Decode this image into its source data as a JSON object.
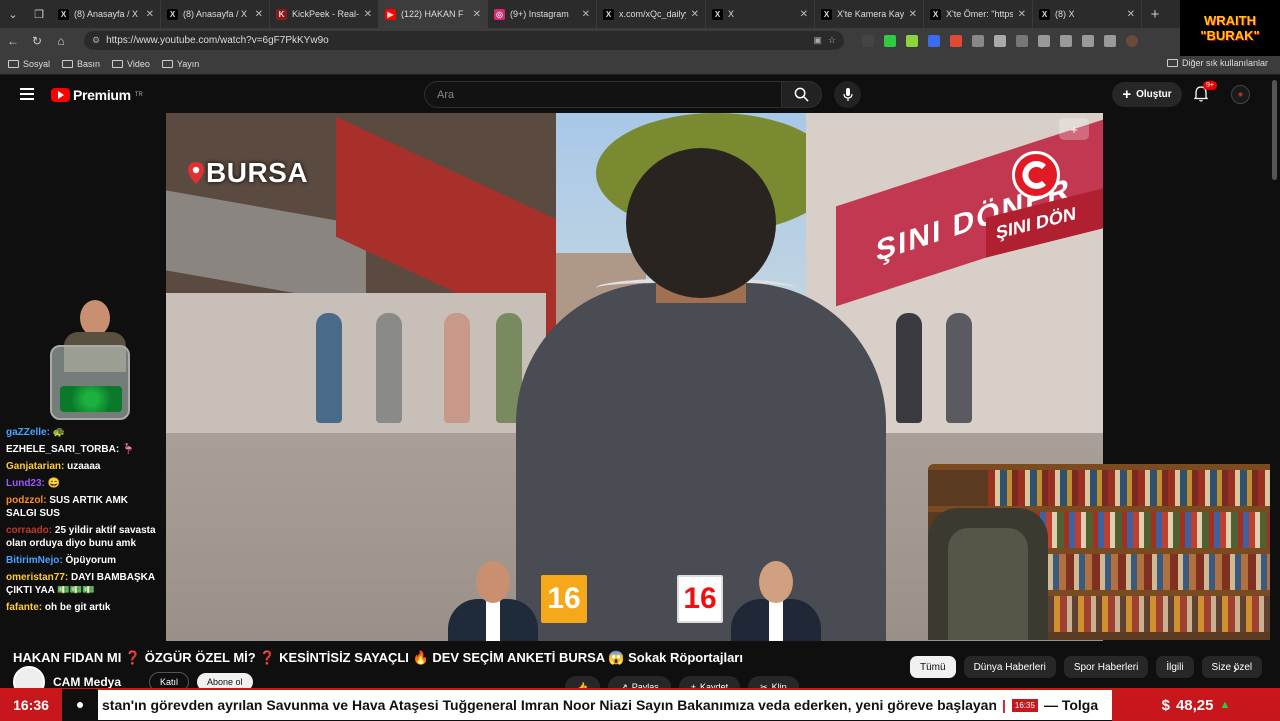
{
  "browser": {
    "tabs": [
      {
        "title": "(8) Anasayfa / X",
        "icon": "x-logo-icon",
        "fav_color": "#000000",
        "glyph": "X"
      },
      {
        "title": "(8) Anasayfa / X",
        "icon": "x-logo-icon",
        "fav_color": "#000000",
        "glyph": "X"
      },
      {
        "title": "KickPeek - Real-time",
        "icon": "kickpeek-icon",
        "fav_color": "#8b1a1a",
        "glyph": "K"
      },
      {
        "title": "(122) HAKAN F",
        "icon": "youtube-icon",
        "fav_color": "#ff0000",
        "glyph": "▶"
      },
      {
        "title": "(9+) Instagram",
        "icon": "instagram-icon",
        "fav_color": "#d62976",
        "glyph": "◎"
      },
      {
        "title": "x.com/xQc_dailyy/st",
        "icon": "x-logo-icon",
        "fav_color": "#000000",
        "glyph": "X"
      },
      {
        "title": "X",
        "icon": "x-logo-icon",
        "fav_color": "#000000",
        "glyph": "X"
      },
      {
        "title": "X'te Kamera Kaydı G",
        "icon": "x-logo-icon",
        "fav_color": "#000000",
        "glyph": "X"
      },
      {
        "title": "X'te Ömer: \"https://x",
        "icon": "x-logo-icon",
        "fav_color": "#000000",
        "glyph": "X"
      },
      {
        "title": "(8) X",
        "icon": "x-logo-icon",
        "fav_color": "#000000",
        "glyph": "X"
      }
    ],
    "url": "https://www.youtube.com/watch?v=6gF7PkKYw9o",
    "bookmarks": [
      "Sosyal",
      "Basın",
      "Video",
      "Yayın"
    ],
    "other_bookmarks": "Diğer sık kullanılanlar",
    "overlay_line1": "WRAITH",
    "overlay_line2": "\"BURAK\""
  },
  "youtube": {
    "brand": "Premium",
    "region": "TR",
    "search_placeholder": "Ara",
    "create_label": "Oluştur",
    "notif_badge": "9+",
    "video_title": "HAKAN FIDAN MI ❓ ÖZGÜR ÖZEL Mİ? ❓ KESİNTİSİZ SAYAÇLI 🔥 DEV SEÇİM ANKETİ BURSA 😱 Sokak Röportajları",
    "channel_name": "CAM Medya",
    "join_label": "Katıl",
    "subscribe_label": "Abone ol",
    "actions": [
      "Paylaş",
      "Kaydet",
      "Klip"
    ],
    "chips": [
      "Tümü",
      "Dünya Haberleri",
      "Spor Haberleri",
      "İlgili",
      "Size özel"
    ]
  },
  "video": {
    "location": "BURSA",
    "sign_text": "ŞINI DÖNER",
    "sign_text2": "ŞINI DÖN",
    "left_count": "16",
    "right_count": "16"
  },
  "chat": [
    {
      "user": "gaZZelle:",
      "color": "#4aa3ff",
      "msg": "🐢"
    },
    {
      "user": "EZHELE_SARI_TORBA:",
      "color": "#ffffff",
      "msg": "🦩"
    },
    {
      "user": "Ganjatarian:",
      "color": "#ffcc33",
      "msg": "uzaaaa"
    },
    {
      "user": "Lund23:",
      "color": "#9b59ff",
      "msg": "😄"
    },
    {
      "user": "podzzol:",
      "color": "#ff8c1a",
      "msg": "SUS ARTIK AMK SALGI SUS"
    },
    {
      "user": "corraado:",
      "color": "#c0392b",
      "msg": "25 yildir aktif savasta olan orduya diyo bunu amk"
    },
    {
      "user": "BitirimNejo:",
      "color": "#4aa3ff",
      "msg": "Öpüyorum"
    },
    {
      "user": "omeristan77:",
      "color": "#ffcc33",
      "msg": "DAYI BAMBAŞKA ÇIKTI YAA 💵💵💵"
    },
    {
      "user": "fafante:",
      "color": "#ffcc33",
      "msg": "oh be git artık"
    }
  ],
  "ticker": {
    "time": "16:36",
    "headline": "stan'ın görevden ayrılan Savunma ve Hava Ataşesi Tuğgeneral Imran Noor Niazi Sayın Bakanımıza veda ederken, yeni göreve başlayan P",
    "time2": "16:35",
    "headline2": "— Tolga",
    "currency": "$",
    "rate": "48,25"
  }
}
